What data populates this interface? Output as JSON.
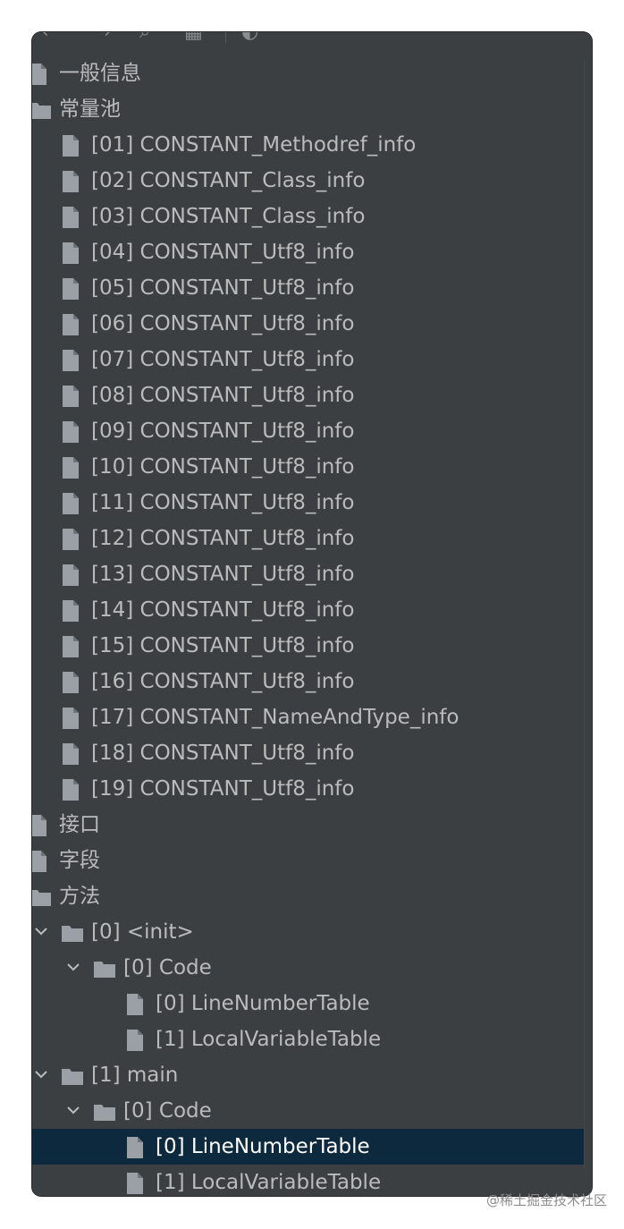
{
  "tree": {
    "items": [
      {
        "label": "一般信息",
        "type": "file",
        "level": 0,
        "expanded": null,
        "selected": false
      },
      {
        "label": "常量池",
        "type": "folder",
        "level": 0,
        "expanded": null,
        "selected": false
      },
      {
        "label": "[01] CONSTANT_Methodref_info",
        "type": "file",
        "level": 1,
        "expanded": null,
        "selected": false
      },
      {
        "label": "[02] CONSTANT_Class_info",
        "type": "file",
        "level": 1,
        "expanded": null,
        "selected": false
      },
      {
        "label": "[03] CONSTANT_Class_info",
        "type": "file",
        "level": 1,
        "expanded": null,
        "selected": false
      },
      {
        "label": "[04] CONSTANT_Utf8_info",
        "type": "file",
        "level": 1,
        "expanded": null,
        "selected": false
      },
      {
        "label": "[05] CONSTANT_Utf8_info",
        "type": "file",
        "level": 1,
        "expanded": null,
        "selected": false
      },
      {
        "label": "[06] CONSTANT_Utf8_info",
        "type": "file",
        "level": 1,
        "expanded": null,
        "selected": false
      },
      {
        "label": "[07] CONSTANT_Utf8_info",
        "type": "file",
        "level": 1,
        "expanded": null,
        "selected": false
      },
      {
        "label": "[08] CONSTANT_Utf8_info",
        "type": "file",
        "level": 1,
        "expanded": null,
        "selected": false
      },
      {
        "label": "[09] CONSTANT_Utf8_info",
        "type": "file",
        "level": 1,
        "expanded": null,
        "selected": false
      },
      {
        "label": "[10] CONSTANT_Utf8_info",
        "type": "file",
        "level": 1,
        "expanded": null,
        "selected": false
      },
      {
        "label": "[11] CONSTANT_Utf8_info",
        "type": "file",
        "level": 1,
        "expanded": null,
        "selected": false
      },
      {
        "label": "[12] CONSTANT_Utf8_info",
        "type": "file",
        "level": 1,
        "expanded": null,
        "selected": false
      },
      {
        "label": "[13] CONSTANT_Utf8_info",
        "type": "file",
        "level": 1,
        "expanded": null,
        "selected": false
      },
      {
        "label": "[14] CONSTANT_Utf8_info",
        "type": "file",
        "level": 1,
        "expanded": null,
        "selected": false
      },
      {
        "label": "[15] CONSTANT_Utf8_info",
        "type": "file",
        "level": 1,
        "expanded": null,
        "selected": false
      },
      {
        "label": "[16] CONSTANT_Utf8_info",
        "type": "file",
        "level": 1,
        "expanded": null,
        "selected": false
      },
      {
        "label": "[17] CONSTANT_NameAndType_info",
        "type": "file",
        "level": 1,
        "expanded": null,
        "selected": false
      },
      {
        "label": "[18] CONSTANT_Utf8_info",
        "type": "file",
        "level": 1,
        "expanded": null,
        "selected": false
      },
      {
        "label": "[19] CONSTANT_Utf8_info",
        "type": "file",
        "level": 1,
        "expanded": null,
        "selected": false
      },
      {
        "label": "接口",
        "type": "file",
        "level": 0,
        "expanded": null,
        "selected": false
      },
      {
        "label": "字段",
        "type": "file",
        "level": 0,
        "expanded": null,
        "selected": false
      },
      {
        "label": "方法",
        "type": "folder",
        "level": 0,
        "expanded": null,
        "selected": false
      },
      {
        "label": "[0] <init>",
        "type": "folder",
        "level": 1,
        "expanded": true,
        "selected": false
      },
      {
        "label": "[0] Code",
        "type": "folder",
        "level": 2,
        "expanded": true,
        "selected": false
      },
      {
        "label": "[0] LineNumberTable",
        "type": "file",
        "level": 3,
        "expanded": null,
        "selected": false
      },
      {
        "label": "[1] LocalVariableTable",
        "type": "file",
        "level": 3,
        "expanded": null,
        "selected": false
      },
      {
        "label": "[1] main",
        "type": "folder",
        "level": 1,
        "expanded": true,
        "selected": false
      },
      {
        "label": "[0] Code",
        "type": "folder",
        "level": 2,
        "expanded": true,
        "selected": false
      },
      {
        "label": "[0] LineNumberTable",
        "type": "file",
        "level": 3,
        "expanded": null,
        "selected": true
      },
      {
        "label": "[1] LocalVariableTable",
        "type": "file",
        "level": 3,
        "expanded": null,
        "selected": false
      }
    ]
  },
  "toolbar": {
    "icons": [
      "back-icon",
      "forward-icon",
      "search-icon",
      "grid-icon",
      "globe-icon"
    ]
  },
  "watermark": "@稀土掘金技术社区",
  "colors": {
    "background": "#3c3f41",
    "text": "#bbbbbb",
    "selection": "#0d293e",
    "icon": "#9aa0a6"
  }
}
